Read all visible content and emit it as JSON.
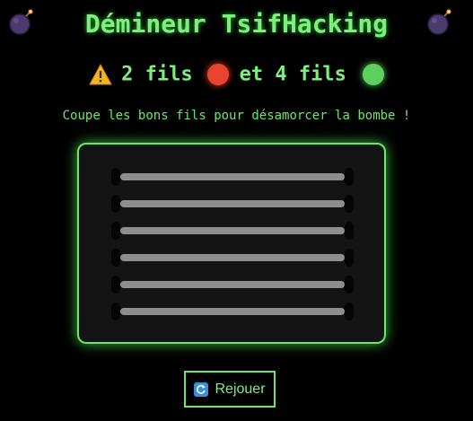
{
  "header": {
    "title": "Démineur TsifHacking",
    "left_icon": "bomb-icon",
    "right_icon": "bomb-icon"
  },
  "info": {
    "warning_icon": "warning-icon",
    "red_count_text": "2 fils",
    "connector_text": "et 4 fils",
    "red_color": "#e8442e",
    "green_color": "#5fcf5f"
  },
  "instructions": "Coupe les bons fils pour désamorcer la bombe !",
  "board": {
    "wires": [
      {
        "state": "intact",
        "color": "#8e8e8e"
      },
      {
        "state": "intact",
        "color": "#8e8e8e"
      },
      {
        "state": "intact",
        "color": "#8e8e8e"
      },
      {
        "state": "intact",
        "color": "#8e8e8e"
      },
      {
        "state": "intact",
        "color": "#8e8e8e"
      },
      {
        "state": "intact",
        "color": "#8e8e8e"
      }
    ]
  },
  "replay_button": {
    "icon": "refresh-icon",
    "label": "Rejouer"
  },
  "colors": {
    "accent": "#6ee66e",
    "background": "#000000",
    "panel": "#141414"
  }
}
